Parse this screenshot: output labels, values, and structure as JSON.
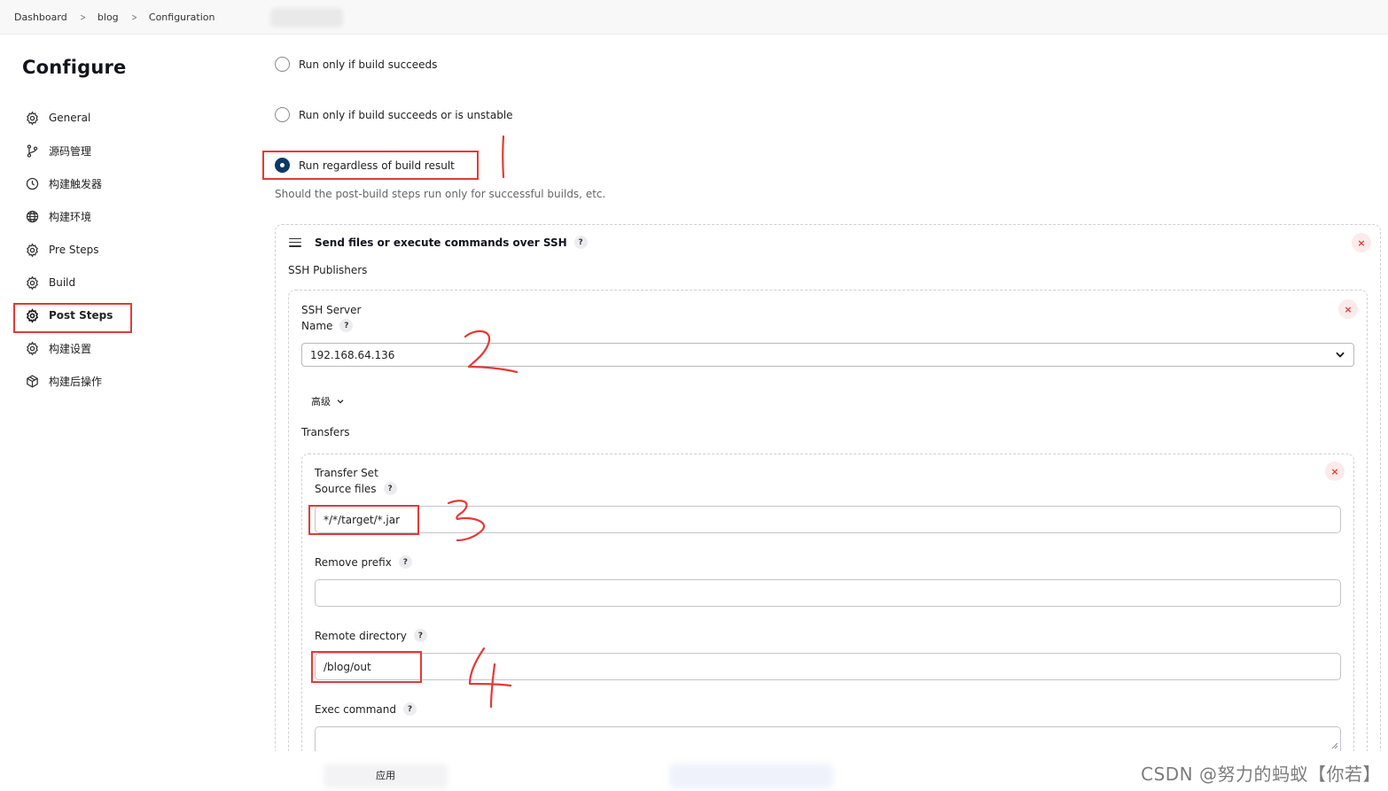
{
  "breadcrumb": {
    "items": [
      "Dashboard",
      "blog",
      "Configuration"
    ]
  },
  "sidebar": {
    "title": "Configure",
    "items": [
      {
        "label": "General",
        "icon": "gear-icon"
      },
      {
        "label": "源码管理",
        "icon": "git-branch-icon"
      },
      {
        "label": "构建触发器",
        "icon": "clock-icon"
      },
      {
        "label": "构建环境",
        "icon": "globe-icon"
      },
      {
        "label": "Pre Steps",
        "icon": "gear-icon"
      },
      {
        "label": "Build",
        "icon": "gear-icon"
      },
      {
        "label": "Post Steps",
        "icon": "gear-icon",
        "active": true
      },
      {
        "label": "构建设置",
        "icon": "gear-icon"
      },
      {
        "label": "构建后操作",
        "icon": "box-icon"
      }
    ]
  },
  "post_steps": {
    "options": [
      {
        "label": "Run only if build succeeds",
        "checked": false
      },
      {
        "label": "Run only if build succeeds or is unstable",
        "checked": false
      },
      {
        "label": "Run regardless of build result",
        "checked": true
      }
    ],
    "help": "Should the post-build steps run only for successful builds, etc."
  },
  "ssh_step": {
    "title": "Send files or execute commands over SSH",
    "help_mark": "?",
    "close_mark": "×",
    "publishers_label": "SSH Publishers",
    "server": {
      "section_label": "SSH Server",
      "name_label": "Name",
      "name_value": "192.168.64.136",
      "advanced_label": "高级"
    },
    "transfers_label": "Transfers",
    "transfer_set": {
      "section_label": "Transfer Set",
      "source_files_label": "Source files",
      "source_files_value": "*/*/target/*.jar",
      "remove_prefix_label": "Remove prefix",
      "remove_prefix_value": "",
      "remote_directory_label": "Remote directory",
      "remote_directory_value": "/blog/out",
      "exec_command_label": "Exec command",
      "exec_command_value": ""
    }
  },
  "footer": {
    "apply_label": "应用"
  },
  "watermark": "CSDN @努力的蚂蚁【你若】",
  "colors": {
    "accent": "#0b3a66",
    "highlight": "#e53935",
    "annotation": "#e53935"
  }
}
